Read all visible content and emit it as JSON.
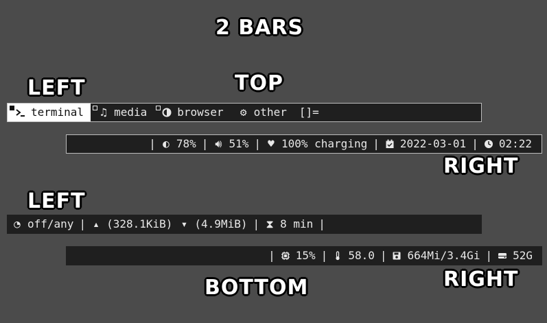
{
  "headings": {
    "title": "2 BARS",
    "top": "TOP",
    "left_top": "LEFT",
    "right_top": "RIGHT",
    "left_bottom": "LEFT",
    "bottom": "BOTTOM",
    "right_bottom": "RIGHT"
  },
  "top_left_bar": {
    "workspaces": [
      {
        "label": "terminal",
        "icon": "terminal-icon",
        "active": true
      },
      {
        "label": "media",
        "icon": "music-note-icon",
        "active": false
      },
      {
        "label": "browser",
        "icon": "browser-icon",
        "active": false
      },
      {
        "label": "other",
        "icon": "gears-icon",
        "active": false
      }
    ],
    "layout_symbol": "[]="
  },
  "top_right_bar": {
    "leading_sep": "|",
    "brightness": "78%",
    "volume": "51%",
    "battery": "100% charging",
    "date": "2022-03-01",
    "time": "02:22"
  },
  "bottom_left_bar": {
    "vpn": "off/any",
    "upload": "(328.1KiB)",
    "download": "(4.9MiB)",
    "timer": "8 min",
    "trailing_sep": "|"
  },
  "bottom_right_bar": {
    "leading_sep": "|",
    "cpu": "15%",
    "temperature": "58.0",
    "memory": "664Mi/3.4Gi",
    "disk": "52G"
  },
  "colors": {
    "background": "#4b4b4b",
    "bar": "#1f1f1f",
    "text": "#e8e8e8",
    "active_workspace": "#ffffff"
  }
}
